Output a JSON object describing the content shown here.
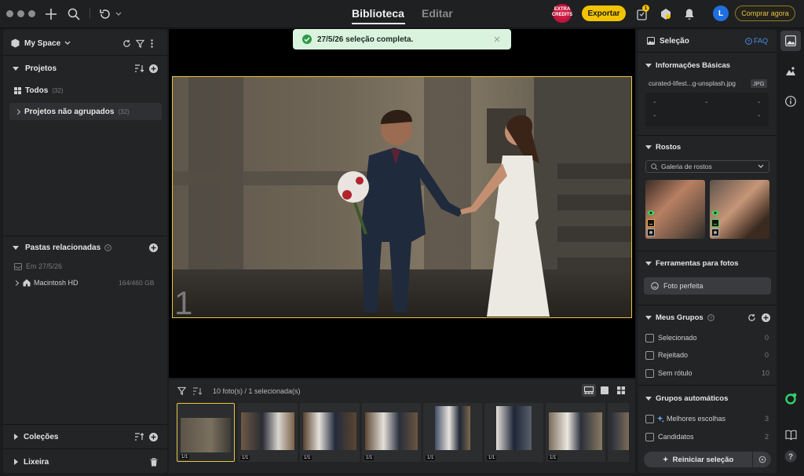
{
  "window": {
    "tabs": [
      "Biblioteca",
      "Editar"
    ],
    "active_tab": "Biblioteca"
  },
  "topbar": {
    "extra_credits": "EXTRA CREDITS",
    "export_label": "Exportar",
    "notification_badge": "1",
    "avatar_initial": "L",
    "buy_label": "Comprar agora"
  },
  "left": {
    "space_title": "My Space",
    "projects_title": "Projetos",
    "all_label": "Todos",
    "all_count": "(32)",
    "ungrouped_label": "Projetos não agrupados",
    "ungrouped_count": "(32)",
    "related_title": "Pastas relacionadas",
    "date_label": "Em 27/5/26",
    "drive_label": "Macintosh HD",
    "drive_size": "164/460 GB",
    "collections_title": "Coleções",
    "trash_title": "Lixeira"
  },
  "toast": {
    "message": "27/5/26 seleção completa."
  },
  "viewer": {
    "photo_number": "1"
  },
  "filmstrip": {
    "count_text": "10 foto(s) / 1 selecionada(s)",
    "thumbs": [
      {
        "tag": "1/1"
      },
      {
        "tag": "1/1"
      },
      {
        "tag": "1/1"
      },
      {
        "tag": "1/1"
      },
      {
        "tag": "1/1"
      },
      {
        "tag": "1/1"
      },
      {
        "tag": "1/1"
      },
      {
        "tag": ""
      }
    ]
  },
  "right": {
    "selection_title": "Seleção",
    "faq_label": "FAQ",
    "basic_info_title": "Informações Básicas",
    "filename": "curated-lifest...g-unsplash.jpg",
    "filetype": "JPG",
    "dash": "-",
    "faces_title": "Rostos",
    "faces_dropdown": "Galeria de rostos",
    "tools_title": "Ferramentas para fotos",
    "perfect_photo": "Foto perfeita",
    "groups_title": "Meus Grupos",
    "groups": [
      {
        "label": "Selecionado",
        "count": "0"
      },
      {
        "label": "Rejeitado",
        "count": "0"
      },
      {
        "label": "Sem rótulo",
        "count": "10"
      }
    ],
    "auto_groups_title": "Grupos automáticos",
    "auto_groups": [
      {
        "label": "Melhores escolhas",
        "count": "3"
      },
      {
        "label": "Candidatos",
        "count": "2"
      }
    ],
    "restart_label": "Reiniciar seleção"
  },
  "colors": {
    "accent_yellow": "#f2c300",
    "selection_border": "#e8c547",
    "avatar_blue": "#1f6fe0",
    "toast_bg": "#d9f3df",
    "toast_check": "#2f9a48"
  }
}
